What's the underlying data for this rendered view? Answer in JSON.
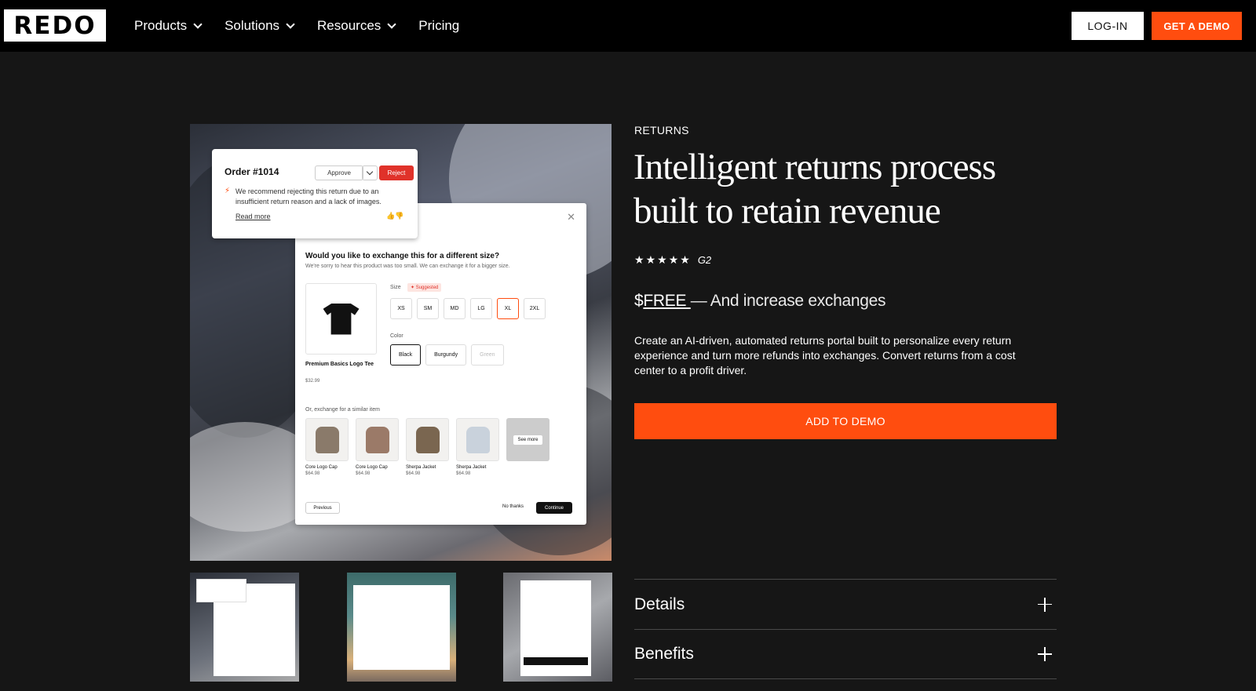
{
  "nav": {
    "logo": "REDO",
    "items": [
      {
        "label": "Products",
        "has_dropdown": true
      },
      {
        "label": "Solutions",
        "has_dropdown": true
      },
      {
        "label": "Resources",
        "has_dropdown": true
      },
      {
        "label": "Pricing",
        "has_dropdown": false
      }
    ],
    "login_label": "LOG-IN",
    "demo_label": "GET A DEMO"
  },
  "hero_image": {
    "order_card": {
      "title": "Order #1014",
      "approve_label": "Approve",
      "reject_label": "Reject",
      "message": "We recommend rejecting this return due to an insufficient return reason and a lack of images.",
      "read_more": "Read more"
    },
    "exchange_card": {
      "question": "Would you like to exchange this for a different size?",
      "subtitle": "We're sorry to hear this product was too small. We can exchange it for a bigger size.",
      "product_name": "Premium Basics Logo Tee",
      "product_price": "$32.99",
      "size_label": "Size",
      "suggested_label": "✦ Suggested",
      "sizes": [
        "XS",
        "SM",
        "MD",
        "LG",
        "XL",
        "2XL"
      ],
      "selected_size": "XL",
      "color_label": "Color",
      "colors": [
        "Black",
        "Burgundy",
        "Green"
      ],
      "selected_color": "Black",
      "similar_label": "Or, exchange for a similar item",
      "similar_items": [
        {
          "name": "Core Logo Cap",
          "price": "$64.98",
          "color": "#8a7a6a"
        },
        {
          "name": "Core Logo Cap",
          "price": "$64.98",
          "color": "#9b7a68"
        },
        {
          "name": "Sherpa Jacket",
          "price": "$64.98",
          "color": "#7a6650"
        },
        {
          "name": "Sherpa Jacket",
          "price": "$64.98",
          "color": "#c9d2dc"
        }
      ],
      "see_more": "See more",
      "previous_label": "Previous",
      "no_thanks_label": "No thanks",
      "continue_label": "Continue"
    }
  },
  "product": {
    "eyebrow": "RETURNS",
    "headline": "Intelligent returns process built to retain revenue",
    "stars": 5,
    "rating_source": "G2",
    "price_prefix": "$",
    "price_value": "FREE ",
    "price_suffix": "— And increase exchanges",
    "description": "Create an AI-driven, automated returns portal built to personalize every return experience and turn more refunds into exchanges. Convert returns from a cost center to a profit driver.",
    "cta_label": "ADD TO DEMO",
    "accordion": [
      "Details",
      "Benefits"
    ]
  },
  "colors": {
    "accent": "#ff4d0f",
    "background": "#161616",
    "nav_background": "#000000"
  }
}
